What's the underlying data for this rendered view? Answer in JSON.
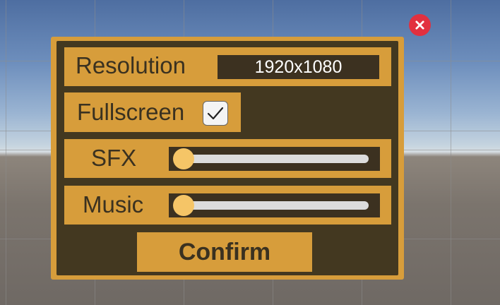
{
  "settings": {
    "resolution": {
      "label": "Resolution",
      "value": "1920x1080"
    },
    "fullscreen": {
      "label": "Fullscreen",
      "checked": true
    },
    "sfx": {
      "label": "SFX",
      "level": 0
    },
    "music": {
      "label": "Music",
      "level": 0
    },
    "confirm_label": "Confirm"
  },
  "colors": {
    "panel": "#d79d3b",
    "panel_dark": "#433820",
    "text": "#3a3120",
    "slider_handle": "#f5c567",
    "close": "#e2303f"
  },
  "icons": {
    "close": "close-icon",
    "check": "checkmark-icon"
  }
}
